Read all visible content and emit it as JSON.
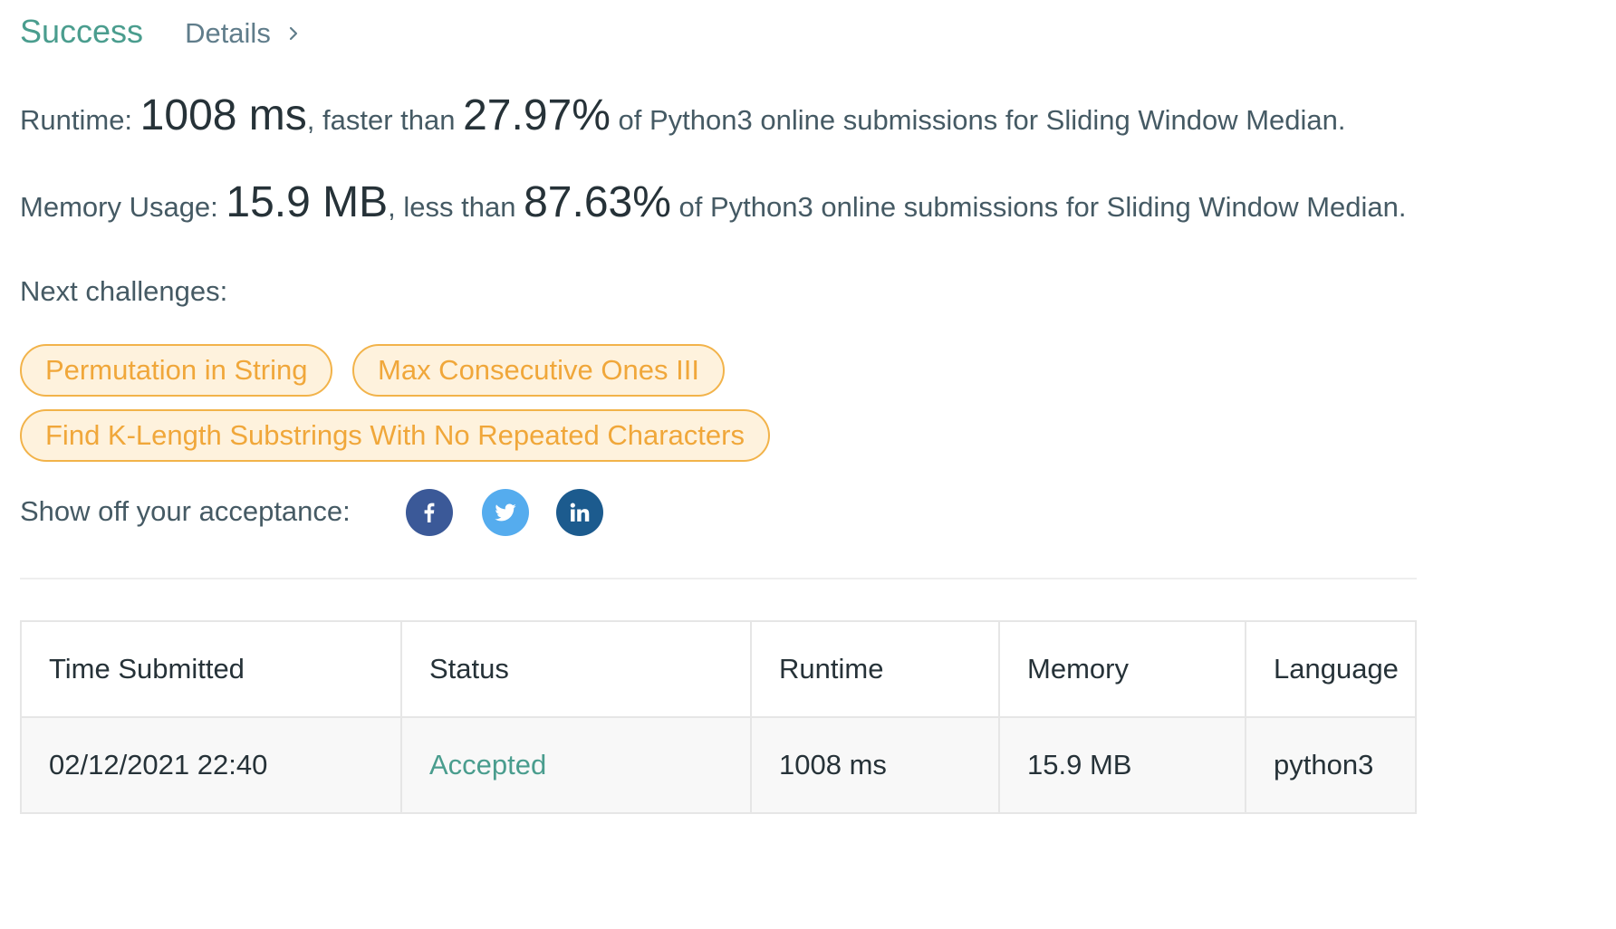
{
  "header": {
    "status": "Success",
    "details_label": "Details"
  },
  "runtime": {
    "label": "Runtime: ",
    "value": "1008 ms",
    "comparison": ", faster than ",
    "percent": "27.97%",
    "suffix": " of Python3 online submissions for Sliding Window Median."
  },
  "memory": {
    "label": "Memory Usage: ",
    "value": "15.9 MB",
    "comparison": ", less than ",
    "percent": "87.63%",
    "suffix": " of Python3 online submissions for Sliding Window Median."
  },
  "next": {
    "label": "Next challenges:",
    "challenges": [
      "Permutation in String",
      "Max Consecutive Ones III",
      "Find K-Length Substrings With No Repeated Characters"
    ]
  },
  "share": {
    "label": "Show off your acceptance:",
    "networks": [
      "facebook-icon",
      "twitter-icon",
      "linkedin-icon"
    ]
  },
  "table": {
    "headers": [
      "Time Submitted",
      "Status",
      "Runtime",
      "Memory",
      "Language"
    ],
    "rows": [
      [
        "02/12/2021 22:40",
        "Accepted",
        "1008 ms",
        "15.9 MB",
        "python3"
      ]
    ]
  },
  "colors": {
    "success": "#4a9d8e",
    "chip_border": "#f2b34a",
    "chip_bg": "#fef2dd",
    "facebook": "#3b5998",
    "twitter": "#55acee",
    "linkedin": "#1c5b8e"
  }
}
